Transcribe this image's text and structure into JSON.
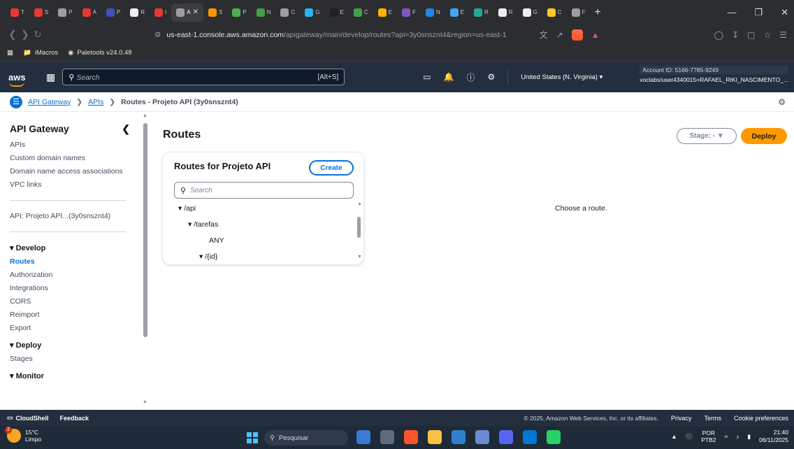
{
  "browser": {
    "tabs": [
      {
        "label": "T",
        "color": "#e53935"
      },
      {
        "label": "S",
        "color": "#e53935"
      },
      {
        "label": "P",
        "color": "#9e9e9e"
      },
      {
        "label": "A",
        "color": "#e53935"
      },
      {
        "label": "P",
        "color": "#3f51b5"
      },
      {
        "label": "R",
        "color": "#eeeeee"
      },
      {
        "label": "I",
        "color": "#e53935"
      },
      {
        "label": "A",
        "color": "#9e9e9e"
      },
      {
        "label": "S",
        "color": "#ff9800"
      },
      {
        "label": "P",
        "color": "#4caf50"
      },
      {
        "label": "N",
        "color": "#43a047"
      },
      {
        "label": "C",
        "color": "#9e9e9e"
      },
      {
        "label": "G",
        "color": "#29b6f6"
      },
      {
        "label": "E",
        "color": "#212121"
      },
      {
        "label": "C",
        "color": "#43a047"
      },
      {
        "label": "E",
        "color": "#ffb300"
      },
      {
        "label": "F",
        "color": "#7e57c2"
      },
      {
        "label": "N",
        "color": "#1e88e5"
      },
      {
        "label": "E",
        "color": "#42a5f5"
      },
      {
        "label": "R",
        "color": "#26a69a"
      },
      {
        "label": "R",
        "color": "#eeeeee"
      },
      {
        "label": "G",
        "color": "#eeeeee"
      },
      {
        "label": "C",
        "color": "#ffca28"
      },
      {
        "label": "F",
        "color": "#9e9e9e"
      }
    ],
    "active_tab_label": "A",
    "new_tab": "+",
    "url_host": "us-east-1.console.aws.amazon.com",
    "url_path": "/apigateway/main/develop/routes?api=3y0snsznt4&region=us-east-1",
    "bookmarks": [
      "iMacros",
      "Paletools v24.0.48"
    ]
  },
  "aws_nav": {
    "logo": "aws",
    "search_placeholder": "Search",
    "search_shortcut": "[Alt+S]",
    "region": "United States (N. Virginia) ▾",
    "account_id": "Account ID: 5166-7785-9249",
    "user": "voclabs/user4340015=RAFAEL_RIKI_NASCIMENTO_..."
  },
  "breadcrumb": {
    "items": [
      "API Gateway",
      "APIs"
    ],
    "current": "Routes - Projeto API (3y0snsznt4)"
  },
  "sidebar": {
    "title": "API Gateway",
    "top_items": [
      "APIs",
      "Custom domain names",
      "Domain name access associations",
      "VPC links"
    ],
    "api_label": "API: Projeto API...(3y0snsznt4)",
    "develop_heading": "▾ Develop",
    "develop_items": [
      "Routes",
      "Authorization",
      "Integrations",
      "CORS",
      "Reimport",
      "Export"
    ],
    "deploy_heading": "▾ Deploy",
    "deploy_items": [
      "Stages"
    ],
    "monitor_heading": "▾ Monitor"
  },
  "main": {
    "title": "Routes",
    "stage_label": "Stage: -",
    "deploy_label": "Deploy",
    "panel_title": "Routes for Projeto API",
    "create_label": "Create",
    "panel_search_placeholder": "Search",
    "tree": [
      {
        "label": "▾ /api"
      },
      {
        "label": "▾ /tarefas"
      },
      {
        "label": "ANY"
      },
      {
        "label": "▾ /{id}"
      }
    ],
    "empty_message": "Choose a route."
  },
  "footer": {
    "cloudshell": "CloudShell",
    "feedback": "Feedback",
    "copyright": "© 2025, Amazon Web Services, Inc. or its affiliates.",
    "privacy": "Privacy",
    "terms": "Terms",
    "cookies": "Cookie preferences"
  },
  "taskbar": {
    "weather_temp": "15°C",
    "weather_desc": "Limpo",
    "weather_badge": "2",
    "search_placeholder": "Pesquisar",
    "lang_top": "POR",
    "lang_bottom": "PTB2",
    "time": "21:40",
    "date": "06/11/2025"
  }
}
